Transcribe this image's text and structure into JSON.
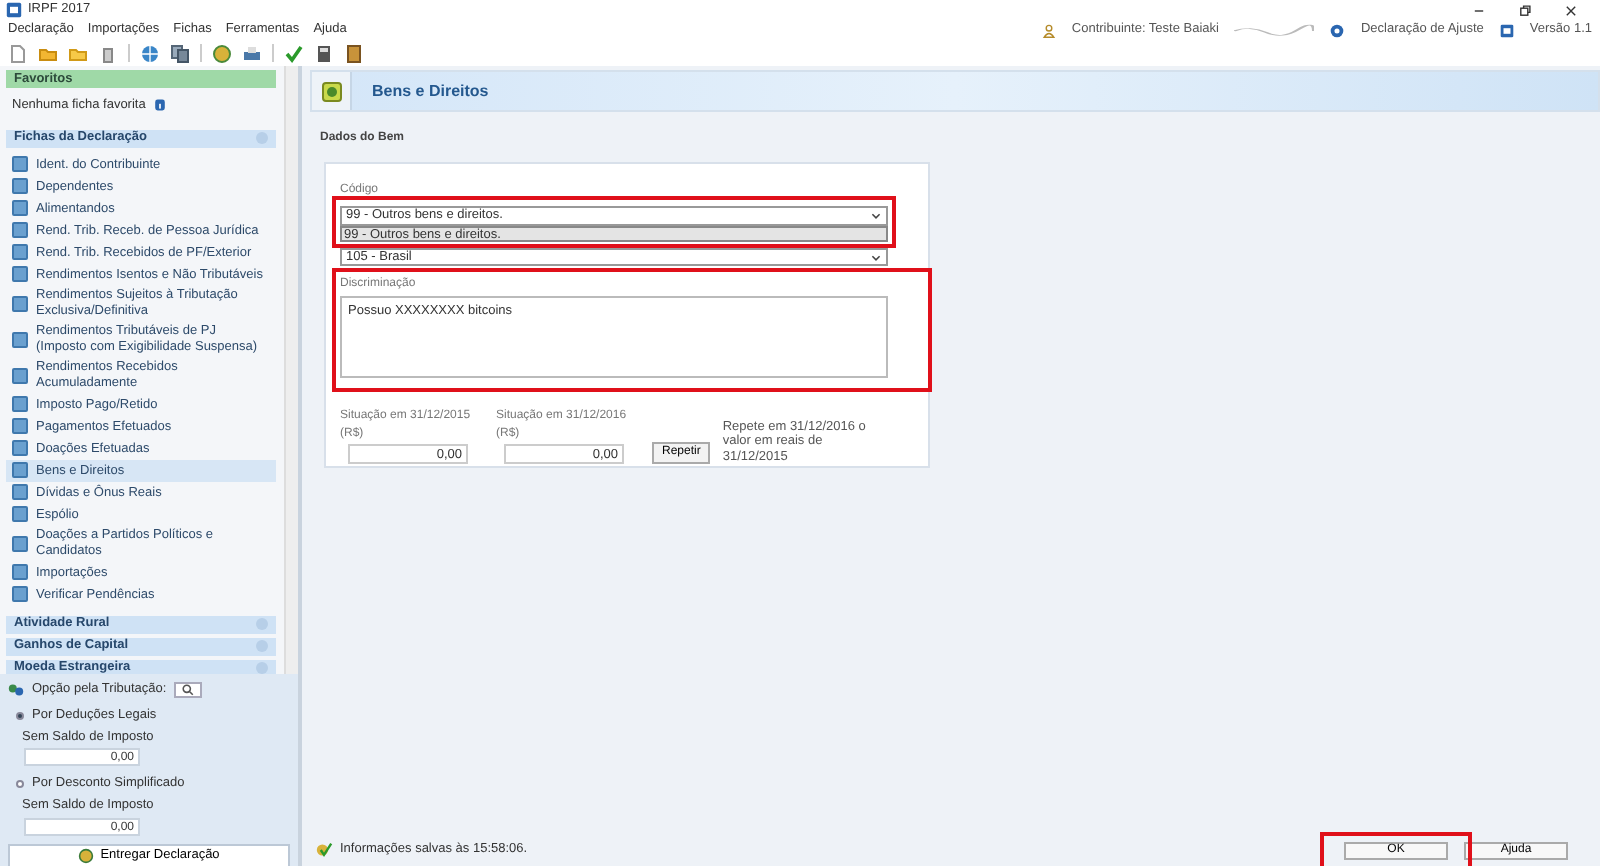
{
  "window": {
    "title": "IRPF 2017"
  },
  "menu": [
    "Declaração",
    "Importações",
    "Fichas",
    "Ferramentas",
    "Ajuda"
  ],
  "header_links": {
    "contribuinte": "Contribuinte: Teste Baiaki",
    "declaracao": "Declaração de Ajuste",
    "versao": "Versão 1.1"
  },
  "sidebar": {
    "favorites": {
      "title": "Favoritos",
      "empty_text": "Nenhuma ficha favorita"
    },
    "fichas": {
      "title": "Fichas da Declaração",
      "items": [
        {
          "label": "Ident. do Contribuinte",
          "selected": false
        },
        {
          "label": "Dependentes",
          "selected": false
        },
        {
          "label": "Alimentandos",
          "selected": false
        },
        {
          "label": "Rend. Trib. Receb. de Pessoa Jurídica",
          "selected": false
        },
        {
          "label": "Rend. Trib. Recebidos de PF/Exterior",
          "selected": false
        },
        {
          "label": "Rendimentos Isentos e Não Tributáveis",
          "selected": false
        },
        {
          "label": "Rendimentos Sujeitos à Tributação Exclusiva/Definitiva",
          "selected": false
        },
        {
          "label": "Rendimentos Tributáveis de PJ (Imposto com Exigibilidade Suspensa)",
          "selected": false
        },
        {
          "label": "Rendimentos Recebidos Acumuladamente",
          "selected": false
        },
        {
          "label": "Imposto Pago/Retido",
          "selected": false
        },
        {
          "label": "Pagamentos Efetuados",
          "selected": false
        },
        {
          "label": "Doações Efetuadas",
          "selected": false
        },
        {
          "label": "Bens e Direitos",
          "selected": true
        },
        {
          "label": "Dívidas e Ônus Reais",
          "selected": false
        },
        {
          "label": "Espólio",
          "selected": false
        },
        {
          "label": "Doações a Partidos Políticos e Candidatos",
          "selected": false
        },
        {
          "label": "Importações",
          "selected": false
        },
        {
          "label": "Verificar Pendências",
          "selected": false
        }
      ]
    },
    "collapsed_sections": [
      "Atividade Rural",
      "Ganhos de Capital",
      "Moeda Estrangeira"
    ],
    "tributacao": {
      "title": "Opção pela Tributação:",
      "options": [
        {
          "label": "Por Deduções Legais",
          "selected": true,
          "balance_label": "Sem Saldo de Imposto",
          "value": "0,00"
        },
        {
          "label": "Por Desconto Simplificado",
          "selected": false,
          "balance_label": "Sem Saldo de Imposto",
          "value": "0,00"
        }
      ]
    },
    "submit_button": "Entregar Declaração"
  },
  "main": {
    "title": "Bens e Direitos",
    "section_title": "Dados do Bem",
    "codigo": {
      "label": "Código",
      "value": "99 - Outros bens e direitos.",
      "dropdown_option": "99 - Outros bens e direitos."
    },
    "pais": {
      "value": "105 - Brasil"
    },
    "discriminacao": {
      "label": "Discriminação",
      "value": "Possuo XXXXXXXX bitcoins"
    },
    "situacao": [
      {
        "label": "Situação em 31/12/2015 (R$)",
        "value": "0,00"
      },
      {
        "label": "Situação em 31/12/2016 (R$)",
        "value": "0,00"
      }
    ],
    "repeat_button": "Repetir",
    "repeat_note": "Repete em 31/12/2016 o valor em reais de 31/12/2015"
  },
  "status_bar": {
    "text": "Informações salvas às 15:58:06.",
    "buttons": [
      "OK",
      "Ajuda"
    ]
  }
}
